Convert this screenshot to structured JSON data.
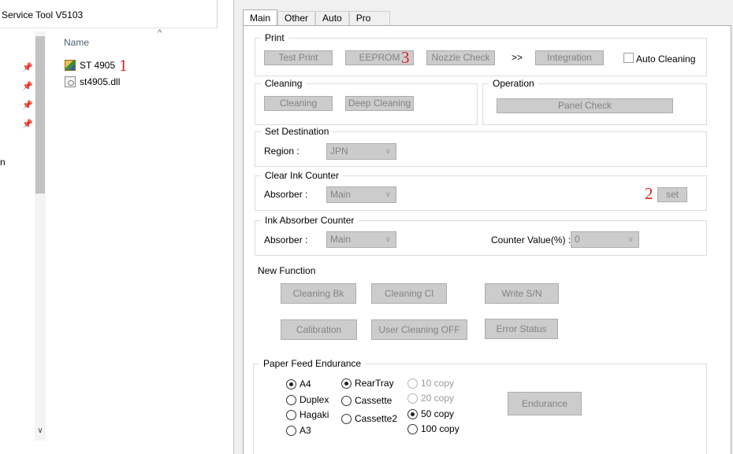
{
  "explorer": {
    "window_title": "Service Tool V5103",
    "column_name": "Name",
    "nav_fragment": "n",
    "files": [
      {
        "name": "ST 4905",
        "icon": "app-icon",
        "marker": "1"
      },
      {
        "name": "st4905.dll",
        "icon": "dll-file-icon"
      }
    ]
  },
  "tool": {
    "tabs": [
      "Main",
      "Other",
      "Auto",
      "Pro"
    ],
    "print": {
      "legend": "Print",
      "test_print": "Test Print",
      "eeprom": "EEPROM",
      "eeprom_marker": "3",
      "nozzle_check": "Nozzle Check",
      "arrows": ">>",
      "integration": "Integration",
      "auto_cleaning": "Auto Cleaning"
    },
    "cleaning": {
      "legend": "Cleaning",
      "cleaning": "Cleaning",
      "deep_cleaning": "Deep Cleaning"
    },
    "operation": {
      "legend": "Operation",
      "panel_check": "Panel Check"
    },
    "set_destination": {
      "legend": "Set Destination",
      "region_label": "Region :",
      "region_value": "JPN"
    },
    "clear_ink_counter": {
      "legend": "Clear Ink Counter",
      "absorber_label": "Absorber :",
      "absorber_value": "Main",
      "set_marker": "2",
      "set_button": "set"
    },
    "ink_absorber_counter": {
      "legend": "Ink Absorber Counter",
      "absorber_label": "Absorber :",
      "absorber_value": "Main",
      "counter_label": "Counter Value(%) :",
      "counter_value": "0"
    },
    "new_function": {
      "label": "New Function",
      "cleaning_bk": "Cleaning Bk",
      "cleaning_cl": "Cleaning Cl",
      "write_sn": "Write S/N",
      "calibration": "Calibration",
      "user_cleaning_off": "User Cleaning OFF",
      "error_status": "Error Status"
    },
    "paper_feed": {
      "legend": "Paper Feed Endurance",
      "paper_sizes": [
        {
          "label": "A4",
          "selected": true
        },
        {
          "label": "Duplex",
          "selected": false
        },
        {
          "label": "Hagaki",
          "selected": false
        },
        {
          "label": "A3",
          "selected": false
        }
      ],
      "trays": [
        {
          "label": "RearTray",
          "selected": true
        },
        {
          "label": "Cassette",
          "selected": false
        },
        {
          "label": "Cassette2",
          "selected": false
        }
      ],
      "copies": [
        {
          "label": "10 copy",
          "selected": false,
          "disabled": true
        },
        {
          "label": "20 copy",
          "selected": false,
          "disabled": true
        },
        {
          "label": "50 copy",
          "selected": true,
          "disabled": false
        },
        {
          "label": "100 copy",
          "selected": false,
          "disabled": false
        }
      ],
      "endurance_button": "Endurance"
    }
  }
}
